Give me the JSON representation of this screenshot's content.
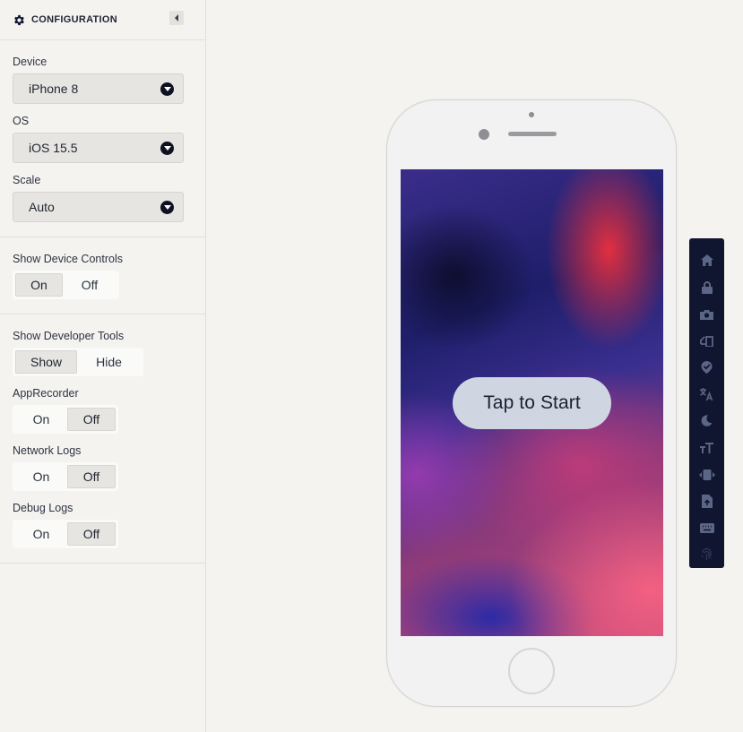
{
  "sidebar": {
    "header_title": "CONFIGURATION",
    "device": {
      "label": "Device",
      "value": "iPhone 8"
    },
    "os": {
      "label": "OS",
      "value": "iOS 15.5"
    },
    "scale": {
      "label": "Scale",
      "value": "Auto"
    },
    "show_device_controls": {
      "label": "Show Device Controls",
      "options": [
        "On",
        "Off"
      ],
      "selected": "On"
    },
    "show_developer_tools": {
      "label": "Show Developer Tools",
      "options": [
        "Show",
        "Hide"
      ],
      "selected": "Show"
    },
    "app_recorder": {
      "label": "AppRecorder",
      "options": [
        "On",
        "Off"
      ],
      "selected": "Off"
    },
    "network_logs": {
      "label": "Network Logs",
      "options": [
        "On",
        "Off"
      ],
      "selected": "Off"
    },
    "debug_logs": {
      "label": "Debug Logs",
      "options": [
        "On",
        "Off"
      ],
      "selected": "Off"
    }
  },
  "phone": {
    "tap_to_start": "Tap to Start"
  },
  "device_controls": [
    "home-icon",
    "lock-icon",
    "camera-icon",
    "rotate-icon",
    "location-icon",
    "translate-icon",
    "dark-mode-icon",
    "text-size-icon",
    "shake-icon",
    "file-upload-icon",
    "keyboard-icon",
    "fingerprint-icon"
  ],
  "colors": {
    "background": "#f4f3f0",
    "controls_bar": "#10162f",
    "tap_button": "#cfd6e2"
  }
}
